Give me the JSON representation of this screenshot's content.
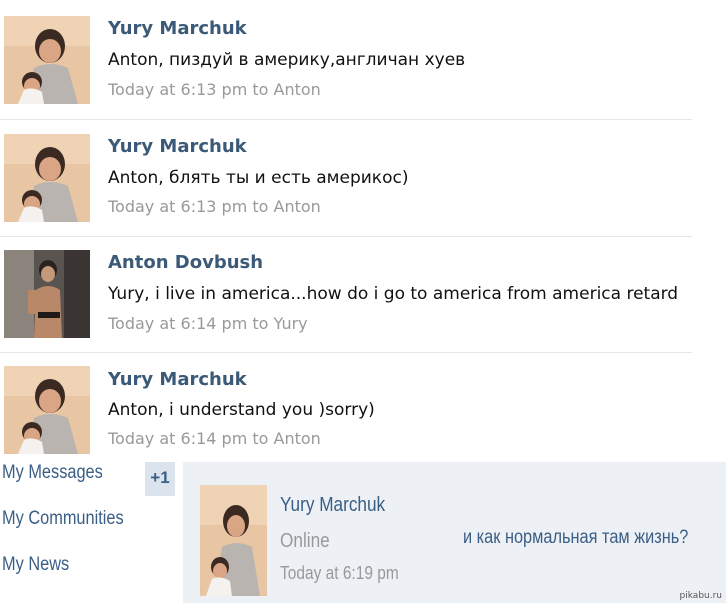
{
  "posts": [
    {
      "author": "Yury Marchuk",
      "text": "Anton, пиздуй в америку,англичан хуев",
      "meta": "Today at 6:13 pm to Anton",
      "avatar": "yury-avatar"
    },
    {
      "author": "Yury Marchuk",
      "text": "Anton, блять ты и есть америкос)",
      "meta": "Today at 6:13 pm to Anton",
      "avatar": "yury-avatar"
    },
    {
      "author": "Anton Dovbush",
      "text": "Yury, i live in america...how do i go to america from america retard",
      "meta": "Today at 6:14 pm to Yury",
      "avatar": "anton-avatar"
    },
    {
      "author": "Yury Marchuk",
      "text": "Anton, i understand you )sorry)",
      "meta": "Today at 6:14 pm to Anton",
      "avatar": "yury-avatar"
    }
  ],
  "sidebar": {
    "items": [
      {
        "label": "My Messages",
        "badge": "+1"
      },
      {
        "label": "My Communities"
      },
      {
        "label": "My News"
      }
    ]
  },
  "dialog": {
    "name": "Yury Marchuk",
    "status": "Online",
    "time": "Today at 6:19 pm",
    "message": "и как нормальная там жизнь?"
  },
  "watermark": "pikabu.ru",
  "colors": {
    "author": "#3b5a78",
    "meta": "#999999",
    "panel": "#edf1f5",
    "link": "#3a5e85"
  }
}
